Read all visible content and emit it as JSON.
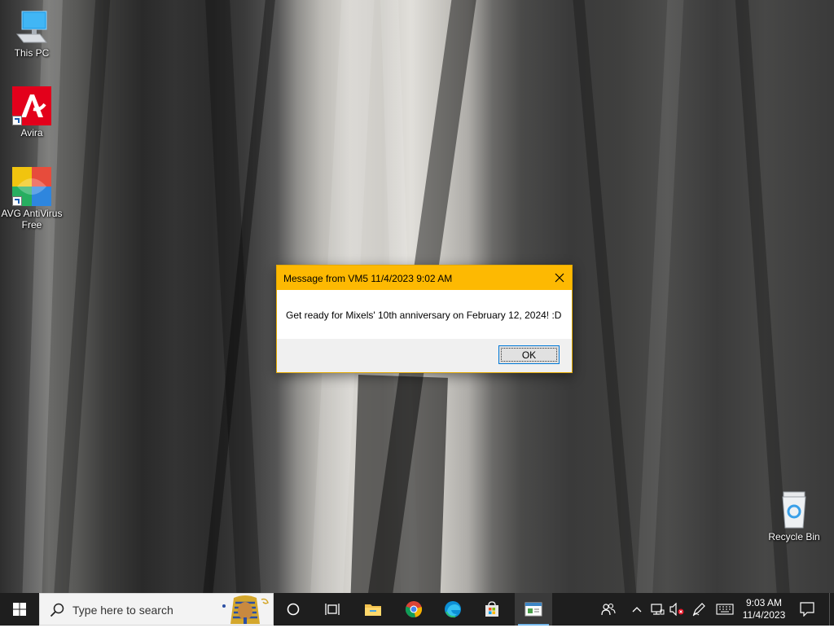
{
  "desktop": {
    "icons": [
      {
        "label": "This PC"
      },
      {
        "label": "Avira"
      },
      {
        "label": "AVG AntiVirus Free"
      },
      {
        "label": "Recycle Bin"
      }
    ]
  },
  "dialog": {
    "title": "Message from VM5 11/4/2023 9:02 AM",
    "message": "Get ready for Mixels' 10th anniversary on February 12, 2024! :D",
    "ok_label": "OK",
    "title_color": "#fdb902"
  },
  "taskbar": {
    "search_placeholder": "Type here to search",
    "clock_time": "9:03 AM",
    "clock_date": "11/4/2023",
    "pinned": [
      "cortana-icon",
      "task-view-icon",
      "file-explorer-icon",
      "chrome-icon",
      "edge-icon",
      "store-icon",
      "active-app-icon"
    ],
    "tray": [
      "people-icon",
      "chevron-up-icon",
      "network-icon",
      "volume-muted-icon",
      "pen-icon",
      "keyboard-icon",
      "notifications-icon"
    ]
  }
}
